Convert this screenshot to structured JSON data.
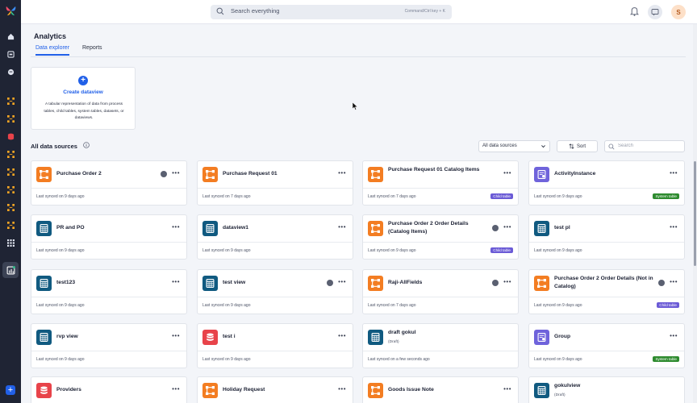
{
  "topbar": {
    "search_placeholder": "Search everything",
    "search_hint": "Command/Ctrl key + K",
    "avatar_initial": "S"
  },
  "page": {
    "title": "Analytics",
    "tabs": [
      {
        "label": "Data explorer",
        "active": true
      },
      {
        "label": "Reports",
        "active": false
      }
    ]
  },
  "create": {
    "title": "Create dataview",
    "description": "A tabular representation of data from process tables, child tables, system tables, datasets, or dataviews."
  },
  "sources": {
    "title": "All data sources",
    "filter_value": "All data sources",
    "sort_label": "Sort",
    "search_placeholder": "Search"
  },
  "colors": {
    "orange": "#f37d22",
    "teal": "#105a80",
    "purple": "#6f63db",
    "red": "#e8434a",
    "accent": "#2160e8"
  },
  "cards": [
    {
      "name": "Purchase Order 2",
      "icon": "process-icon",
      "color": "orange",
      "sync": "Last synced on 9 days ago",
      "badge": "",
      "user": true
    },
    {
      "name": "Purchase Request 01",
      "icon": "process-icon",
      "color": "orange",
      "sync": "Last synced on 7 days ago",
      "badge": "",
      "user": false
    },
    {
      "name": "Purchase Request 01 Catalog Items",
      "icon": "process-icon",
      "color": "orange",
      "sync": "Last synced on 7 days ago",
      "badge": "Child table",
      "user": false
    },
    {
      "name": "ActivityInstance",
      "icon": "system-table-icon",
      "color": "purple",
      "sync": "Last synced on 9 days ago",
      "badge": "System table",
      "user": false
    },
    {
      "name": "PR and PO",
      "icon": "dataview-icon",
      "color": "teal",
      "sync": "Last synced on 9 days ago",
      "badge": "",
      "user": false
    },
    {
      "name": "dataview1",
      "icon": "dataview-icon",
      "color": "teal",
      "sync": "Last synced on 9 days ago",
      "badge": "",
      "user": false
    },
    {
      "name": "Purchase Order 2 Order Details (Catalog Items)",
      "icon": "process-icon",
      "color": "orange",
      "sync": "Last synced on 9 days ago",
      "badge": "Child table",
      "user": true
    },
    {
      "name": "test pl",
      "icon": "dataview-icon",
      "color": "teal",
      "sync": "Last synced on 9 days ago",
      "badge": "",
      "user": false
    },
    {
      "name": "test123",
      "icon": "dataview-icon",
      "color": "teal",
      "sync": "Last synced on 9 days ago",
      "badge": "",
      "user": false
    },
    {
      "name": "test view",
      "icon": "dataview-icon",
      "color": "teal",
      "sync": "Last synced on 9 days ago",
      "badge": "",
      "user": true
    },
    {
      "name": "Raji-AllFields",
      "icon": "process-icon",
      "color": "orange",
      "sync": "Last synced on 7 days ago",
      "badge": "",
      "user": true
    },
    {
      "name": "Purchase Order 2 Order Details (Not in Catalog)",
      "icon": "process-icon",
      "color": "orange",
      "sync": "Last synced on 9 days ago",
      "badge": "Child table",
      "user": true
    },
    {
      "name": "rvp view",
      "icon": "dataview-icon",
      "color": "teal",
      "sync": "Last synced on 9 days ago",
      "badge": "",
      "user": false
    },
    {
      "name": "test i",
      "icon": "dataset-icon",
      "color": "red",
      "sync": "Last synced on 9 days ago",
      "badge": "",
      "user": false
    },
    {
      "name": "draft gokul",
      "sub": "(Draft)",
      "icon": "dataview-icon",
      "color": "teal",
      "sync": "Last synced on a few seconds ago",
      "badge": "",
      "user": false,
      "nomore": true
    },
    {
      "name": "Group",
      "icon": "system-table-icon",
      "color": "purple",
      "sync": "Last synced on 9 days ago",
      "badge": "System table",
      "user": false
    },
    {
      "name": "Providers",
      "icon": "dataset-icon",
      "color": "red",
      "sync": "",
      "badge": "",
      "user": false
    },
    {
      "name": "Holiday Request",
      "icon": "process-icon",
      "color": "orange",
      "sync": "",
      "badge": "",
      "user": false
    },
    {
      "name": "Goods Issue Note",
      "icon": "process-icon",
      "color": "orange",
      "sync": "",
      "badge": "",
      "user": false
    },
    {
      "name": "gokulview",
      "sub": "(Draft)",
      "icon": "dataview-icon",
      "color": "teal",
      "sync": "",
      "badge": "",
      "user": false,
      "nomore": true
    }
  ]
}
